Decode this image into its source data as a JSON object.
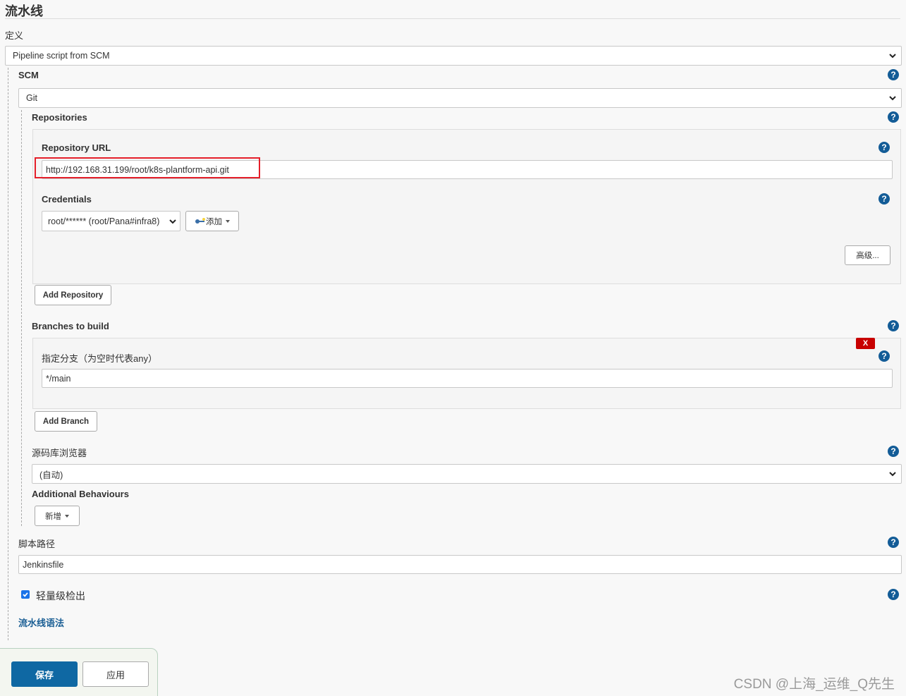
{
  "section": {
    "title": "流水线"
  },
  "definition": {
    "label": "定义",
    "selected": "Pipeline script from SCM"
  },
  "scm": {
    "label": "SCM",
    "selected": "Git",
    "repositories": {
      "label": "Repositories",
      "repository_url_label": "Repository URL",
      "repository_url_value": "http://192.168.31.199/root/k8s-plantform-api.git",
      "credentials_label": "Credentials",
      "credentials_selected": "root/****** (root/Pana#infra8)",
      "add_label": "添加",
      "advanced_label": "高级...",
      "add_repository_label": "Add Repository"
    },
    "branches": {
      "label": "Branches to build",
      "branch_spec_label": "指定分支（为空时代表any）",
      "branch_spec_value": "*/main",
      "delete_label": "X",
      "add_branch_label": "Add Branch"
    },
    "browser": {
      "label": "源码库浏览器",
      "selected": "(自动)"
    },
    "additional_behaviours": {
      "label": "Additional Behaviours",
      "add_label": "新增"
    }
  },
  "script_path": {
    "label": "脚本路径",
    "value": "Jenkinsfile"
  },
  "lightweight_checkout": {
    "label": "轻量级检出",
    "checked": true
  },
  "pipeline_syntax_link": "流水线语法",
  "actions": {
    "save_label": "保存",
    "apply_label": "应用"
  },
  "help_icon_glyph": "?",
  "watermark": "CSDN @上海_运维_Q先生",
  "colors": {
    "primary": "#0f68a3",
    "help": "#135c97",
    "danger": "#c80000",
    "highlight": "#e51f2a",
    "link": "#1a5e94"
  }
}
